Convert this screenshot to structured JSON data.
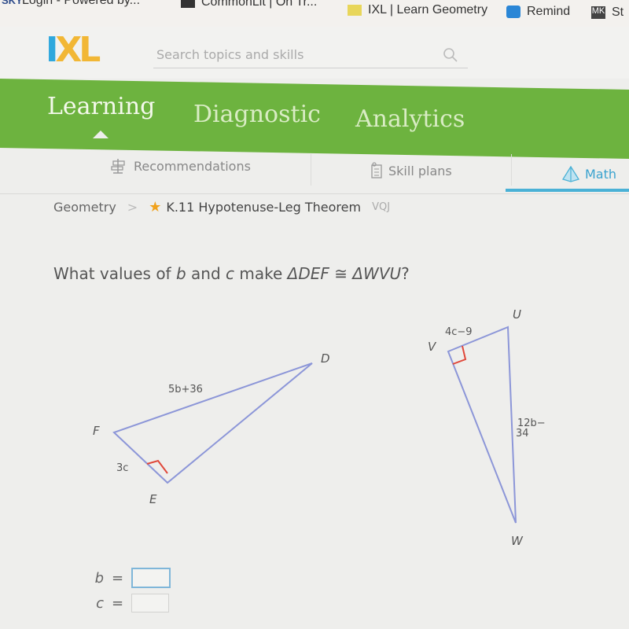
{
  "bookmarks": [
    {
      "label": "Login - Powered by...",
      "icon": "sky-icon"
    },
    {
      "label": "CommonLit | On Tr...",
      "icon": "book-icon"
    },
    {
      "label": "IXL | Learn Geometry",
      "icon": "ixl-icon"
    },
    {
      "label": "Remind",
      "icon": "remind-icon"
    },
    {
      "label": "St",
      "icon": "mk-icon"
    }
  ],
  "header": {
    "logo_i": "I",
    "logo_xl": "XL",
    "search_placeholder": "Search topics and skills"
  },
  "nav": {
    "items": [
      {
        "label": "Learning",
        "active": true
      },
      {
        "label": "Diagnostic",
        "active": false
      },
      {
        "label": "Analytics",
        "active": false
      }
    ]
  },
  "subnav": {
    "items": [
      {
        "label": "Recommendations",
        "icon": "signpost-icon"
      },
      {
        "label": "Skill plans",
        "icon": "clipboard-icon"
      },
      {
        "label": "Math",
        "icon": "pyramid-icon",
        "active": true
      }
    ]
  },
  "breadcrumb": {
    "subject": "Geometry",
    "separator": ">",
    "skill": "K.11 Hypotenuse-Leg Theorem",
    "code": "VQJ"
  },
  "question": {
    "prefix": "What values of ",
    "var_b": "b",
    "middle": " and ",
    "var_c": "c",
    "suffix": " make ",
    "tri1": "ΔDEF",
    "congruent": " ≅ ",
    "tri2": "ΔWVU",
    "end": "?"
  },
  "diagram": {
    "triangle1": {
      "vertices": {
        "D": "D",
        "E": "E",
        "F": "F"
      },
      "hypotenuse_label": "5b+36",
      "leg_label": "3c"
    },
    "triangle2": {
      "vertices": {
        "U": "U",
        "V": "V",
        "W": "W"
      },
      "leg_label": "4c−9",
      "hypotenuse_label_line1": "12b−",
      "hypotenuse_label_line2": "34"
    },
    "colors": {
      "line": "#8c96d8",
      "right_angle": "#e0483a"
    }
  },
  "answers": [
    {
      "variable": "b",
      "equals": "=",
      "value": ""
    },
    {
      "variable": "c",
      "equals": "=",
      "value": ""
    }
  ]
}
